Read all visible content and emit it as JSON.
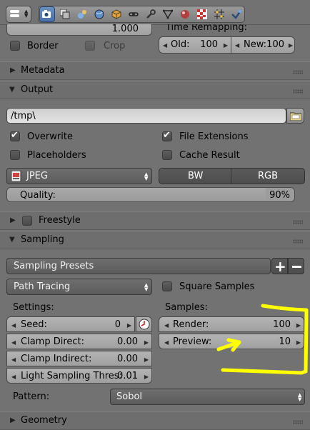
{
  "header": {
    "tabs": [
      "render-icon",
      "render-layers-icon",
      "scene-icon",
      "world-icon",
      "object-icon",
      "constraints-icon",
      "modifiers-icon",
      "data-icon",
      "material-icon",
      "texture-icon",
      "particles-icon",
      "physics-icon"
    ]
  },
  "top": {
    "partial_value": "1.000",
    "time_remapping_label": "Time Remapping:",
    "border_label": "Border",
    "crop_label": "Crop",
    "old_label": "Old:",
    "old_value": "100",
    "new_label": "New:",
    "new_value": "100"
  },
  "panels": {
    "metadata": "Metadata",
    "output": "Output",
    "freestyle": "Freestyle",
    "sampling": "Sampling",
    "geometry": "Geometry"
  },
  "output": {
    "path": "/tmp\\",
    "overwrite": "Overwrite",
    "file_extensions": "File Extensions",
    "placeholders": "Placeholders",
    "cache_result": "Cache Result",
    "format": "JPEG",
    "bw": "BW",
    "rgb": "RGB",
    "quality_label": "Quality:",
    "quality_value": "90%",
    "quality_fraction": 0.9
  },
  "sampling": {
    "presets": "Sampling Presets",
    "integrator": "Path Tracing",
    "square_samples": "Square Samples",
    "settings_label": "Settings:",
    "samples_label": "Samples:",
    "seed_label": "Seed:",
    "seed_value": "0",
    "clamp_direct_label": "Clamp Direct:",
    "clamp_direct_value": "0.00",
    "clamp_indirect_label": "Clamp Indirect:",
    "clamp_indirect_value": "0.00",
    "light_sampling_label": "Light Sampling Thres:",
    "light_sampling_value": "0.01",
    "render_label": "Render:",
    "render_value": "100",
    "preview_label": "Preview:",
    "preview_value": "10",
    "pattern_label": "Pattern:",
    "pattern_value": "Sobol"
  },
  "colors": {
    "annotation": "#ffff00",
    "panel_bg": "#727272",
    "active_tab": "#5a80b8"
  }
}
